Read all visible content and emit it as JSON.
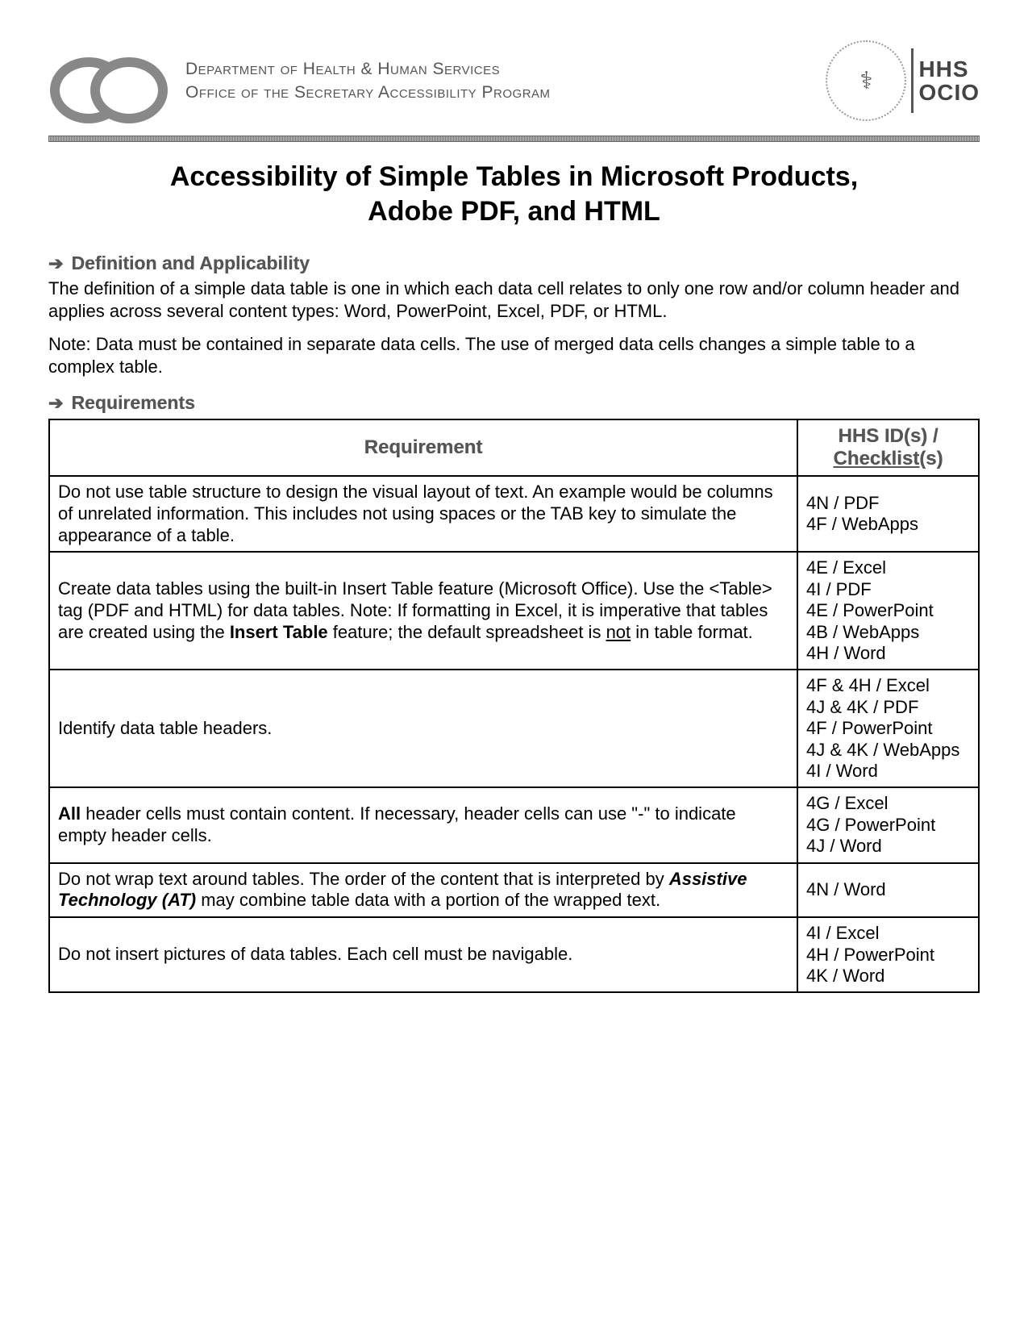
{
  "header": {
    "department": "Department of Health & Human Services",
    "office": "Office of the Secretary Accessibility Program",
    "seal_glyph": "⚕",
    "org_line1": "HHS",
    "org_line2": "OCIO"
  },
  "title": "Accessibility of Simple Tables in Microsoft Products, Adobe PDF, and HTML",
  "section_definition_heading": "Definition and Applicability",
  "definition_paragraph": "The definition of a simple data table is one in which each data cell relates to only one row and/or column header and applies across several content types: Word, PowerPoint, Excel, PDF, or HTML.",
  "note_paragraph": "Note: Data must be contained in separate data cells. The use of merged data cells changes a simple table to a complex table.",
  "section_requirements_heading": "Requirements",
  "table": {
    "col1": "Requirement",
    "col2_line1": "HHS ID(s) /",
    "col2_line2": "Checklist",
    "col2_suffix": "(s)",
    "rows": [
      {
        "req_plain": "Do not use table structure to design the visual layout of text. An example would be columns of unrelated information. This includes not using spaces or the TAB key to simulate the appearance of a table.",
        "ids": "4N / PDF\n4F / WebApps"
      },
      {
        "req_prefix": "Create data tables using the built-in Insert Table feature (Microsoft Office). Use the <Table> tag (PDF and HTML) for data tables. Note: If formatting in Excel, it is imperative that tables are created using the ",
        "req_bold": "Insert Table",
        "req_mid": " feature; the default spreadsheet is ",
        "req_underline": "not",
        "req_suffix": " in table format.",
        "ids": "4E / Excel\n4I / PDF\n4E / PowerPoint\n4B / WebApps\n4H / Word"
      },
      {
        "req_plain": "Identify data table headers.",
        "ids": "4F & 4H / Excel\n4J & 4K / PDF\n4F / PowerPoint\n4J & 4K / WebApps\n4I / Word"
      },
      {
        "req_bold_start": "All",
        "req_suffix": " header cells must contain content. If necessary, header cells can use \"-\" to indicate empty header cells.",
        "ids": "4G / Excel\n4G / PowerPoint\n4J / Word"
      },
      {
        "req_prefix": "Do not wrap text around tables. The order of the content that is interpreted by ",
        "req_bi": "Assistive Technology (AT)",
        "req_suffix": " may combine table data with a portion of the wrapped text.",
        "ids": "4N / Word"
      },
      {
        "req_plain": "Do not insert pictures of data tables. Each cell must be navigable.",
        "ids": "4I / Excel\n4H / PowerPoint\n4K / Word"
      }
    ]
  }
}
